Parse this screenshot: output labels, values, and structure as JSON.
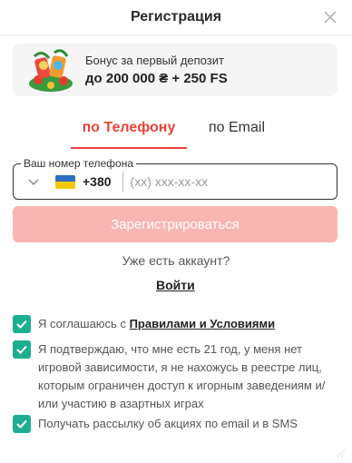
{
  "header": {
    "title": "Регистрация"
  },
  "bonus": {
    "line1": "Бонус за первый депозит",
    "line2": "до 200 000 ₴ + 250 FS"
  },
  "tabs": [
    {
      "label": "по Телефону",
      "active": true
    },
    {
      "label": "по Email",
      "active": false
    }
  ],
  "phone_field": {
    "label": "Ваш номер телефона",
    "country_code": "+380",
    "placeholder": "(xx) xxx-xx-xx",
    "value": ""
  },
  "submit_label": "Зарегистрироваться",
  "login": {
    "prompt": "Уже есть аккаунт?",
    "link": "Войти"
  },
  "agreements": [
    {
      "prefix": "Я соглашаюсь с ",
      "link": "Правилами и Условиями",
      "checked": true
    },
    {
      "text": "Я подтверждаю, что мне есть 21 год, у меня нет игровой зависимости, я не нахожусь в реестре лиц, которым ограничен доступ к игорным заведениям и/или участию в азартных играх",
      "checked": true
    },
    {
      "text": "Получать рассылку об акциях по email и в SMS",
      "checked": true
    }
  ],
  "colors": {
    "accent": "#e9443a",
    "submit_disabled": "#f8b5b1",
    "checkbox": "#1dae91"
  }
}
